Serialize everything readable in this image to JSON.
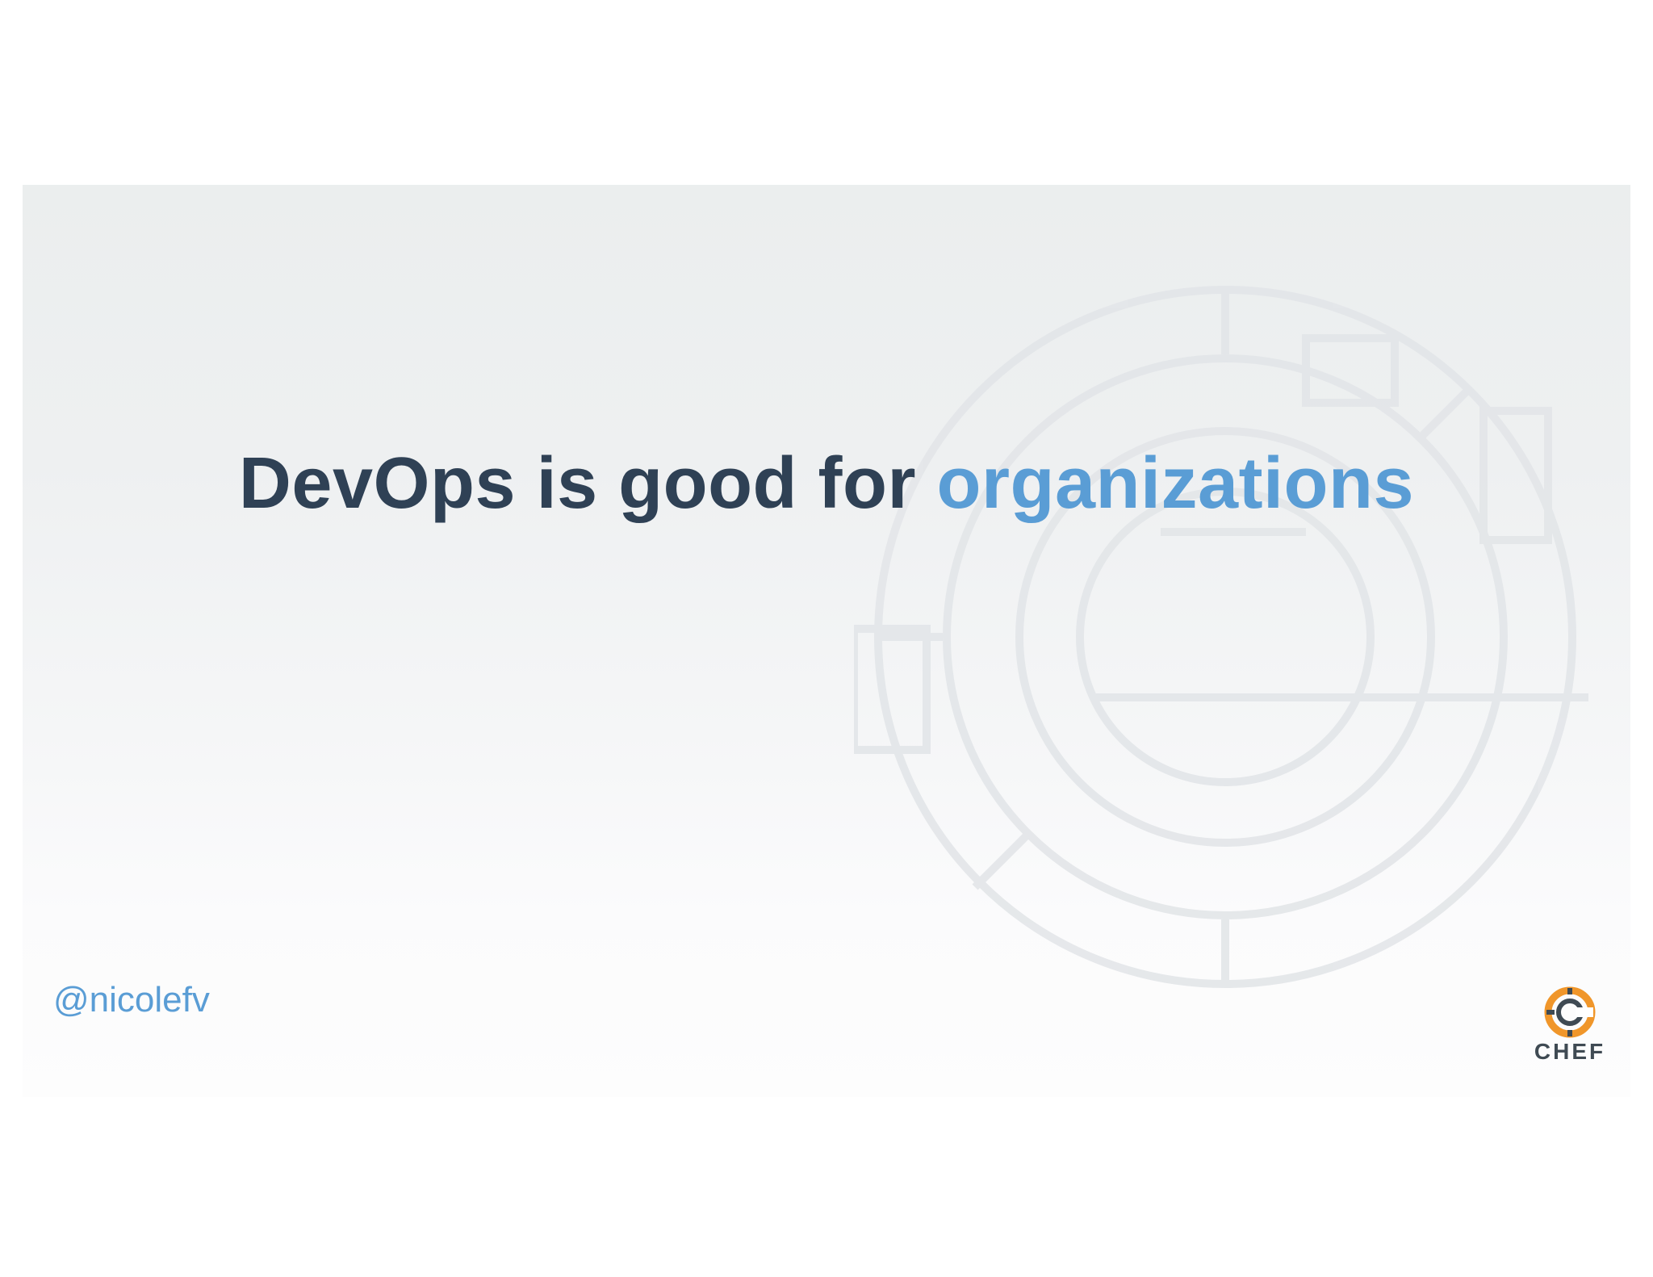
{
  "slide": {
    "title_main": "DevOps is good for ",
    "title_accent": "organizations",
    "handle": "@nicolefv"
  },
  "logo": {
    "wordmark": "CHEF",
    "icon": "chef-logo-icon"
  },
  "colors": {
    "title_dark": "#2f4155",
    "accent_blue": "#5a9dd5",
    "logo_orange": "#f0962a",
    "logo_gray": "#3f4a53"
  }
}
